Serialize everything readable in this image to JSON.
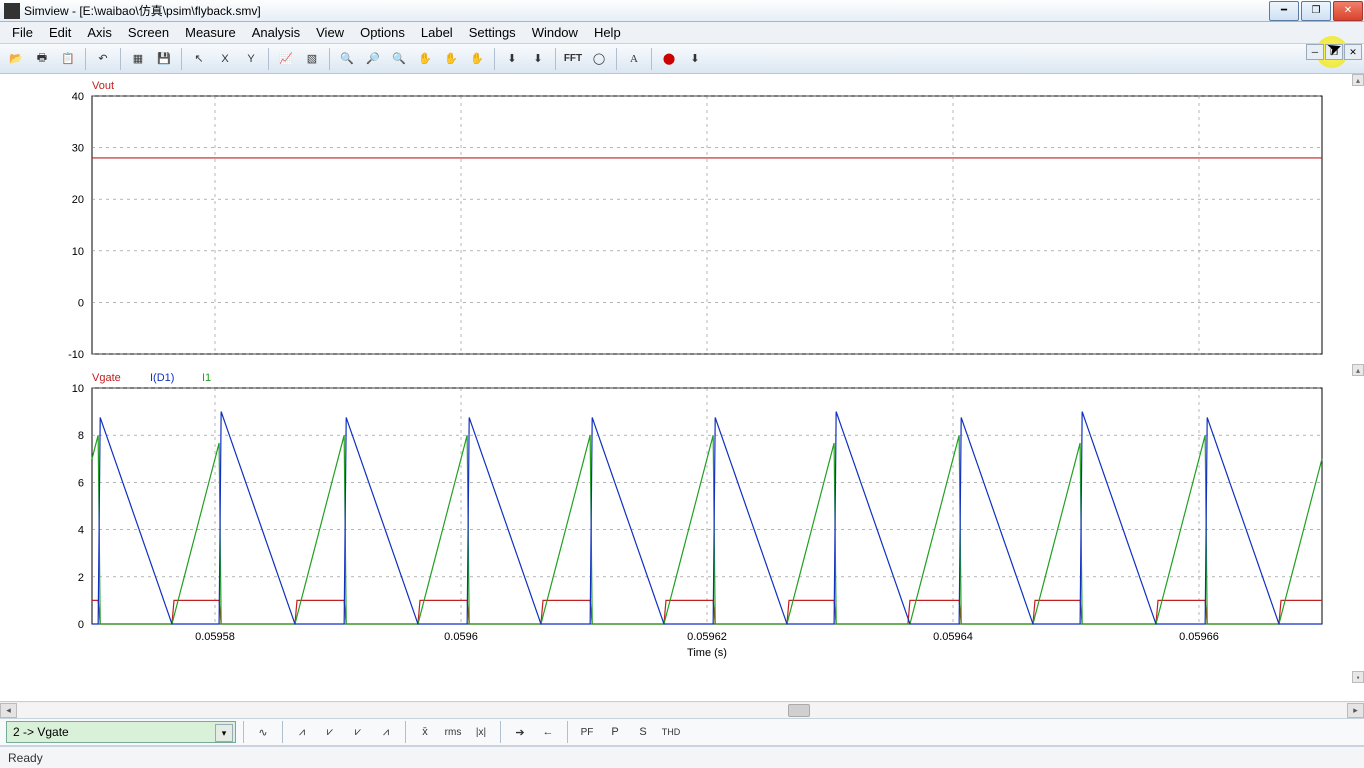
{
  "title": "Simview - [E:\\waibao\\仿真\\psim\\flyback.smv]",
  "menus": [
    "File",
    "Edit",
    "Axis",
    "Screen",
    "Measure",
    "Analysis",
    "View",
    "Options",
    "Label",
    "Settings",
    "Window",
    "Help"
  ],
  "status": "Ready",
  "combo_value": "2 -> Vgate",
  "bottom_buttons_text": {
    "pf": "PF",
    "p": "P",
    "s": "S",
    "thd": "THD",
    "xbar": "x̄",
    "rms": "rms",
    "absx": "|x|"
  },
  "toolbar_text": {
    "x": "X",
    "y": "Y",
    "fft": "FFT",
    "a": "A"
  },
  "chart_data": [
    {
      "type": "line",
      "title": "Vout",
      "xlabel": "Time (s)",
      "ylabel": "",
      "ylim": [
        -10,
        40
      ],
      "yticks": [
        -10,
        0,
        10,
        20,
        30,
        40
      ],
      "xlim": [
        0.05957,
        0.05967
      ],
      "xticks": [
        0.05958,
        0.0596,
        0.05962,
        0.05964,
        0.05966
      ],
      "series": [
        {
          "name": "Vout",
          "color": "#c02020",
          "constant": 28
        }
      ]
    },
    {
      "type": "line",
      "title_series": [
        "Vgate",
        "I(D1)",
        "I1"
      ],
      "xlabel": "Time (s)",
      "ylabel": "",
      "ylim": [
        0,
        10
      ],
      "yticks": [
        0,
        2,
        4,
        6,
        8,
        10
      ],
      "xlim": [
        0.05957,
        0.05967
      ],
      "xticks": [
        0.05958,
        0.0596,
        0.05962,
        0.05964,
        0.05966
      ],
      "period_s": 1e-05,
      "duty_cycle": 0.4,
      "periods_shown": 10,
      "series": [
        {
          "name": "Vgate",
          "color": "#c02020",
          "pulse_low": 0,
          "pulse_high": 1,
          "description": "square pulse, high during first 40% of each period"
        },
        {
          "name": "I(D1)",
          "color": "#1030c0",
          "description": "sawtooth: 0 at period start, step to ~9 at 40% point then linear ramp down to 0 by period end",
          "peak": 9
        },
        {
          "name": "I1",
          "color": "#20a020",
          "description": "ramp from 0 to ~8 during first 40% of each period then drop to 0",
          "peak": 8
        }
      ]
    }
  ],
  "axis_label": "Time (s)"
}
